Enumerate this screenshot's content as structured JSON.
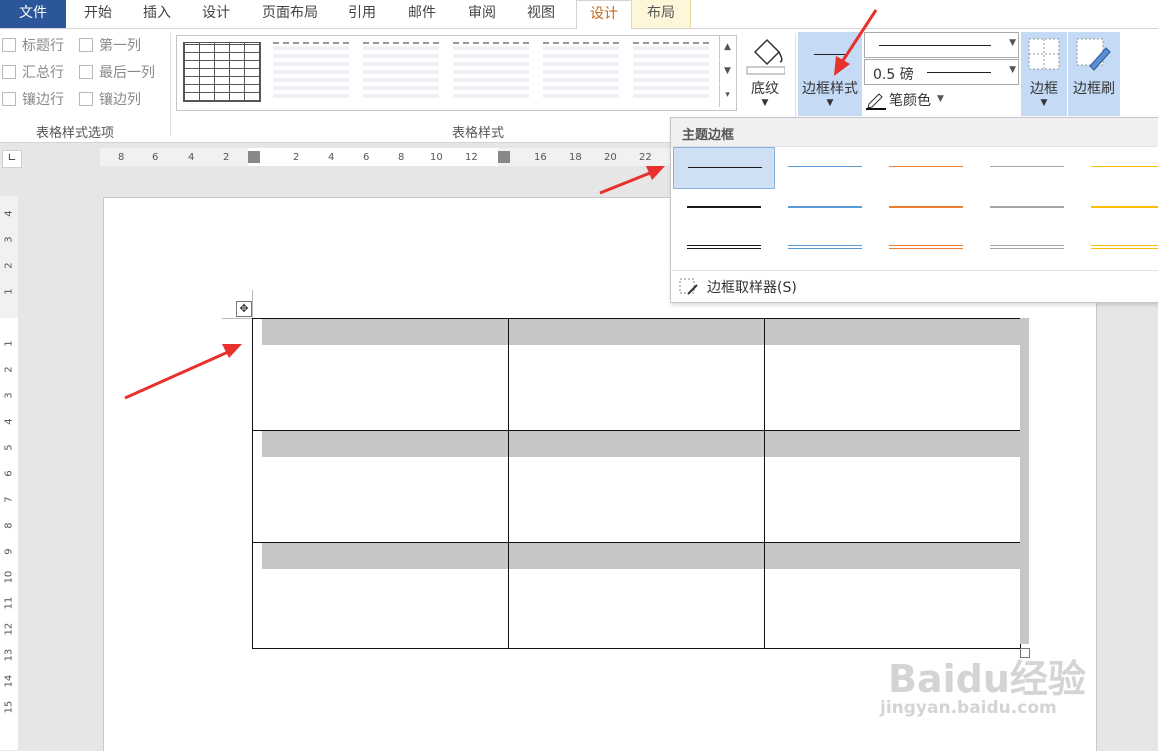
{
  "tabs": [
    {
      "label": "文件",
      "kind": "file"
    },
    {
      "label": "开始"
    },
    {
      "label": "插入"
    },
    {
      "label": "设计"
    },
    {
      "label": "页面布局"
    },
    {
      "label": "引用"
    },
    {
      "label": "邮件"
    },
    {
      "label": "审阅"
    },
    {
      "label": "视图"
    },
    {
      "label": "设计",
      "kind": "ctx-active"
    },
    {
      "label": "布局",
      "kind": "ctx"
    }
  ],
  "style_options": {
    "items": [
      "标题行",
      "第一列",
      "汇总行",
      "最后一列",
      "镶边行",
      "镶边列"
    ],
    "group_label": "表格样式选项"
  },
  "table_styles": {
    "group_label": "表格样式"
  },
  "shading_button": {
    "label": "底纹"
  },
  "border_style_button": {
    "label": "边框样式"
  },
  "pen_weight": {
    "value": "0.5 磅"
  },
  "pen_color": {
    "label": "笔颜色"
  },
  "borders_button": {
    "label": "边框"
  },
  "border_painter_button": {
    "label": "边框刷"
  },
  "dropdown": {
    "header": "主题边框",
    "footer": "边框取样器(S)",
    "colors": [
      "#1a1a1a",
      "#5b9bd5",
      "#ed7d31",
      "#a5a5a5",
      "#ffc000"
    ]
  },
  "ruler": {
    "h_labels": [
      "8",
      "6",
      "4",
      "2",
      "",
      "2",
      "4",
      "6",
      "8",
      "10",
      "12",
      "",
      "16",
      "18",
      "20",
      "22"
    ],
    "v_labels": [
      "4",
      "3",
      "2",
      "1",
      "",
      "1",
      "2",
      "3",
      "4",
      "5",
      "6",
      "7",
      "8",
      "9",
      "10",
      "11",
      "12",
      "13",
      "14",
      "15"
    ]
  },
  "watermark": {
    "brand": "Baidu经验",
    "url": "jingyan.baidu.com"
  }
}
